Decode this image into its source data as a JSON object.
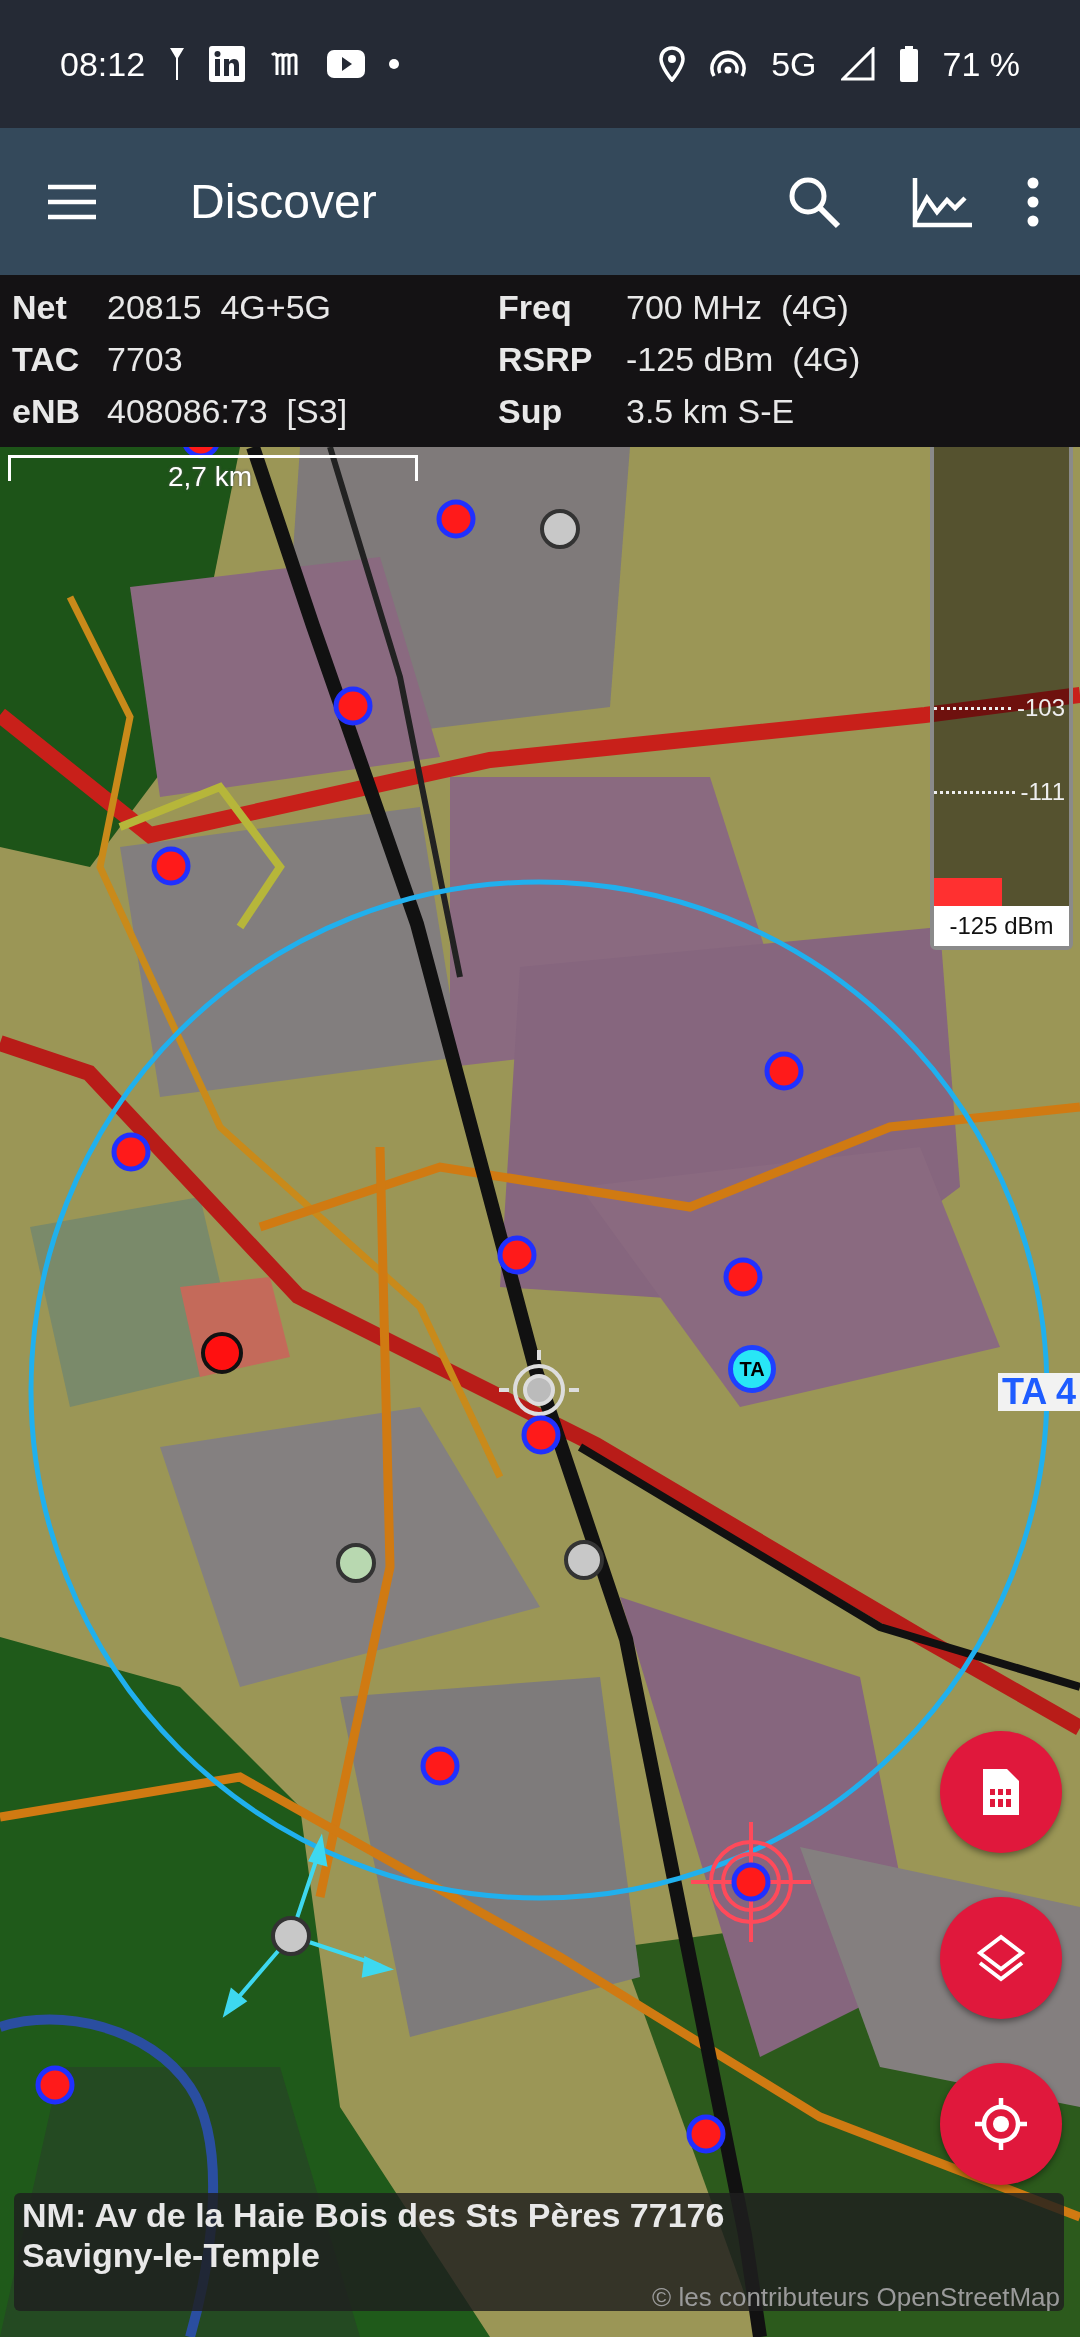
{
  "status_bar": {
    "time": "08:12",
    "network": "5G",
    "battery": "71 %"
  },
  "app_bar": {
    "title": "Discover"
  },
  "cell_info": {
    "left": [
      {
        "label": "Net",
        "value": "20815  4G+5G"
      },
      {
        "label": "TAC",
        "value": "7703"
      },
      {
        "label": "eNB",
        "value": "408086:73  [S3]"
      }
    ],
    "right": [
      {
        "label": "Freq",
        "value": "700 MHz  (4G)"
      },
      {
        "label": "RSRP",
        "value": "-125 dBm  (4G)"
      },
      {
        "label": "Sup",
        "value": "3.5 km S-E"
      }
    ]
  },
  "map": {
    "scale": "2,7 km",
    "ta_marker": "TA",
    "ta_label": "TA 4",
    "attribution": "© les contributeurs OpenStreetMap"
  },
  "signal_meter": {
    "ticks": [
      "-103",
      "-111"
    ],
    "level": 0.06,
    "reading": "-125 dBm"
  },
  "address": "NM: Av de la Haie Bois des Sts Pères 77176 Savigny-le-Temple"
}
